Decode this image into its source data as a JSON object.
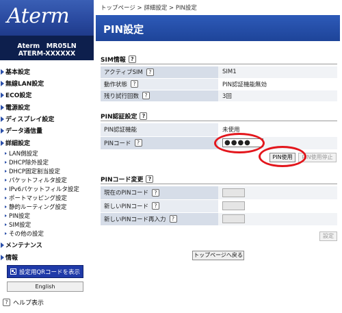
{
  "sidebar": {
    "logo": "Aterm",
    "model_line1": "Aterm　MR05LN",
    "model_line2": "ATERM-XXXXXX",
    "nav": [
      {
        "label": "基本設定"
      },
      {
        "label": "無線LAN設定"
      },
      {
        "label": "ECO設定"
      },
      {
        "label": "電源設定"
      },
      {
        "label": "ディスプレイ設定"
      },
      {
        "label": "データ通信量"
      },
      {
        "label": "詳細設定"
      }
    ],
    "sub_nav": [
      {
        "label": "LAN側設定"
      },
      {
        "label": "DHCP除外設定"
      },
      {
        "label": "DHCP固定割当設定"
      },
      {
        "label": "パケットフィルタ設定"
      },
      {
        "label": "IPv6パケットフィルタ設定"
      },
      {
        "label": "ポートマッピング設定"
      },
      {
        "label": "静的ルーティング設定"
      },
      {
        "label": "PIN設定"
      },
      {
        "label": "SIM設定"
      },
      {
        "label": "その他の設定"
      }
    ],
    "nav_bottom": [
      {
        "label": "メンテナンス"
      },
      {
        "label": "情報"
      }
    ],
    "qr_button": "設定用QRコードを表示",
    "english_button": "English",
    "help": "ヘルプ表示"
  },
  "main": {
    "breadcrumb": "トップページ > 詳細設定 > PIN設定",
    "title": "PIN設定",
    "sim_info": {
      "heading": "SIM情報",
      "rows": [
        {
          "label": "アクティブSIM",
          "value": "SIM1"
        },
        {
          "label": "動作状態",
          "value": "PIN認証機能無効"
        },
        {
          "label": "残り試行回数",
          "value": "3回"
        }
      ]
    },
    "pin_auth": {
      "heading": "PIN認証設定",
      "feature_label": "PIN認証機能",
      "feature_value": "未使用",
      "pin_label": "PINコード",
      "pin_value": "●●●●",
      "enable_button": "PIN使用",
      "disable_button": "PIN使用停止"
    },
    "pin_change": {
      "heading": "PINコード変更",
      "rows": [
        {
          "label": "現在のPINコード"
        },
        {
          "label": "新しいPINコード"
        },
        {
          "label": "新しいPINコード再入力"
        }
      ],
      "set_button": "設定"
    },
    "back_button": "トップページへ戻る"
  },
  "colors": {
    "brand_blue": "#2a4aa0",
    "model_bg": "#0d1f4d",
    "highlight": "#e3161c"
  },
  "icons": {
    "help": "question-icon",
    "nav_bullet": "triangle-right-icon",
    "qr": "qr-code-icon"
  }
}
